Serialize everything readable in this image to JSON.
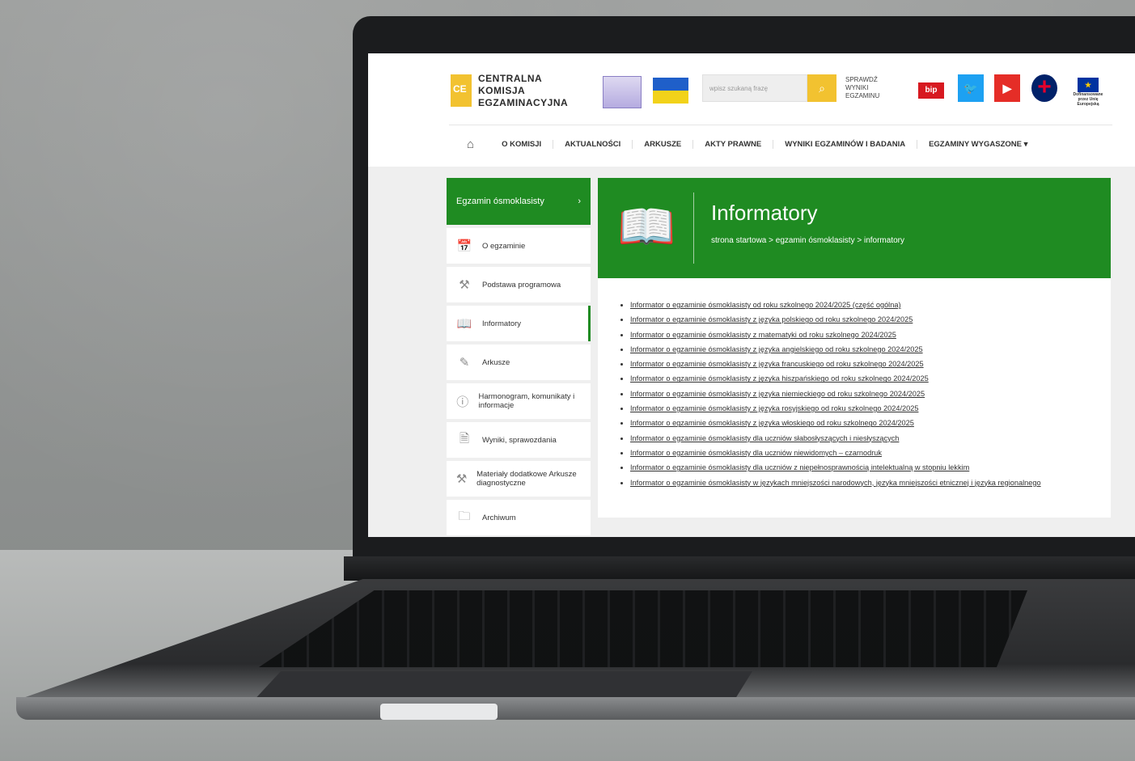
{
  "header": {
    "logo_lines": [
      "CENTRALNA",
      "KOMISJA",
      "EGZAMINACYJNA"
    ],
    "search_placeholder": "wpisz szukaną frazę",
    "check_results": "SPRAWDŹ WYNIKI EGZAMINU",
    "bip_label": "bip",
    "eu_text": "Dofinansowane przez Unię Europejską"
  },
  "nav": {
    "home_icon": "home-icon",
    "items": [
      "O KOMISJI",
      "AKTUALNOŚCI",
      "ARKUSZE",
      "AKTY PRAWNE",
      "WYNIKI EGZAMINÓW I BADANIA",
      "EGZAMINY WYGASZONE ▾"
    ]
  },
  "sidebar": {
    "title": "Egzamin ósmoklasisty",
    "items": [
      {
        "label": "O egzaminie",
        "icon": "calendar-icon"
      },
      {
        "label": "Podstawa programowa",
        "icon": "tools-icon"
      },
      {
        "label": "Informatory",
        "icon": "book-icon"
      },
      {
        "label": "Arkusze",
        "icon": "edit-icon"
      },
      {
        "label": "Harmonogram, komunikaty i informacje",
        "icon": "info-icon"
      },
      {
        "label": "Wyniki, sprawozdania",
        "icon": "document-icon"
      },
      {
        "label": "Materiały dodatkowe Arkusze diagnostyczne",
        "icon": "tools-icon"
      },
      {
        "label": "Archiwum",
        "icon": "archive-icon"
      }
    ]
  },
  "main": {
    "title": "Informatory",
    "breadcrumb": "strona startowa > egzamin ósmoklasisty > informatory",
    "links": [
      "Informator o egzaminie ósmoklasisty od roku szkolnego 2024/2025 (część ogólna)",
      "Informator o egzaminie ósmoklasisty z języka polskiego od roku szkolnego 2024/2025",
      "Informator o egzaminie ósmoklasisty z matematyki od roku szkolnego 2024/2025",
      "Informator o egzaminie ósmoklasisty z języka angielskiego od roku szkolnego 2024/2025",
      "Informator o egzaminie ósmoklasisty z języka francuskiego od roku szkolnego 2024/2025",
      "Informator o egzaminie ósmoklasisty z języka hiszpańskiego od roku szkolnego 2024/2025",
      "Informator o egzaminie ósmoklasisty z języka niemieckiego od roku szkolnego 2024/2025",
      "Informator o egzaminie ósmoklasisty z języka rosyjskiego od roku szkolnego 2024/2025",
      "Informator o egzaminie ósmoklasisty z języka włoskiego od roku szkolnego 2024/2025",
      "Informator o egzaminie ósmoklasisty dla uczniów słabosłyszących i niesłyszących",
      "Informator o egzaminie ósmoklasisty dla uczniów niewidomych – czarnodruk",
      "Informator o egzaminie ósmoklasisty dla uczniów z niepełnosprawnością intelektualną w stopniu lekkim",
      "Informator o egzaminie ósmoklasisty w językach mniejszości narodowych, języka mniejszości etnicznej i języka regionalnego"
    ]
  },
  "colors": {
    "green": "#1f8b22",
    "yellow": "#f2c230"
  }
}
